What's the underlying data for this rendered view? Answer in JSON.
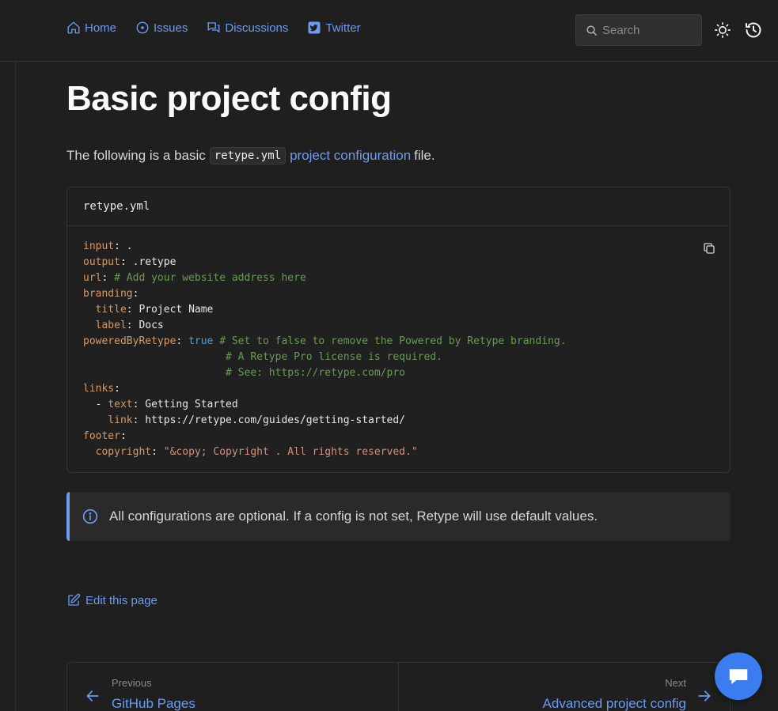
{
  "nav": {
    "links": [
      {
        "label": "Home",
        "icon": "home-icon"
      },
      {
        "label": "Issues",
        "icon": "issue-icon"
      },
      {
        "label": "Discussions",
        "icon": "discussions-icon"
      },
      {
        "label": "Twitter",
        "icon": "twitter-icon"
      }
    ]
  },
  "search": {
    "placeholder": "Search"
  },
  "page": {
    "title": "Basic project config",
    "intro_before": "The following is a basic",
    "intro_code": "retype.yml",
    "intro_link": "project configuration",
    "intro_after": "file."
  },
  "code": {
    "filename": "retype.yml",
    "lines": {
      "l1k": "input",
      "l1v": " .",
      "l2k": "output",
      "l2v": " .retype",
      "l3k": "url",
      "l3c": " # Add your website address here",
      "l4k": "branding",
      "l5k": "title",
      "l5v": " Project Name",
      "l6k": "label",
      "l6v": " Docs",
      "l7k": "poweredByRetype",
      "l7b": "true",
      "l7c": " # Set to false to remove the Powered by Retype branding.",
      "l8c": "# A Retype Pro license is required.",
      "l9c": "# See: https://retype.com/pro",
      "l10k": "links",
      "l11k": "text",
      "l11v": " Getting Started",
      "l12k": "link",
      "l12v": " https://retype.com/guides/getting-started/",
      "l13k": "footer",
      "l14k": "copyright",
      "l14s": "\"&copy; Copyright . All rights reserved.\""
    }
  },
  "callout": {
    "text": "All configurations are optional. If a config is not set, Retype will use default values."
  },
  "edit": {
    "label": "Edit this page"
  },
  "pager": {
    "prev_small": "Previous",
    "prev_title": "GitHub Pages",
    "next_small": "Next",
    "next_title": "Advanced project config"
  },
  "colors": {
    "accent": "#6b9bf2",
    "fab": "#3b7cf0",
    "background": "#1f1f1f"
  }
}
